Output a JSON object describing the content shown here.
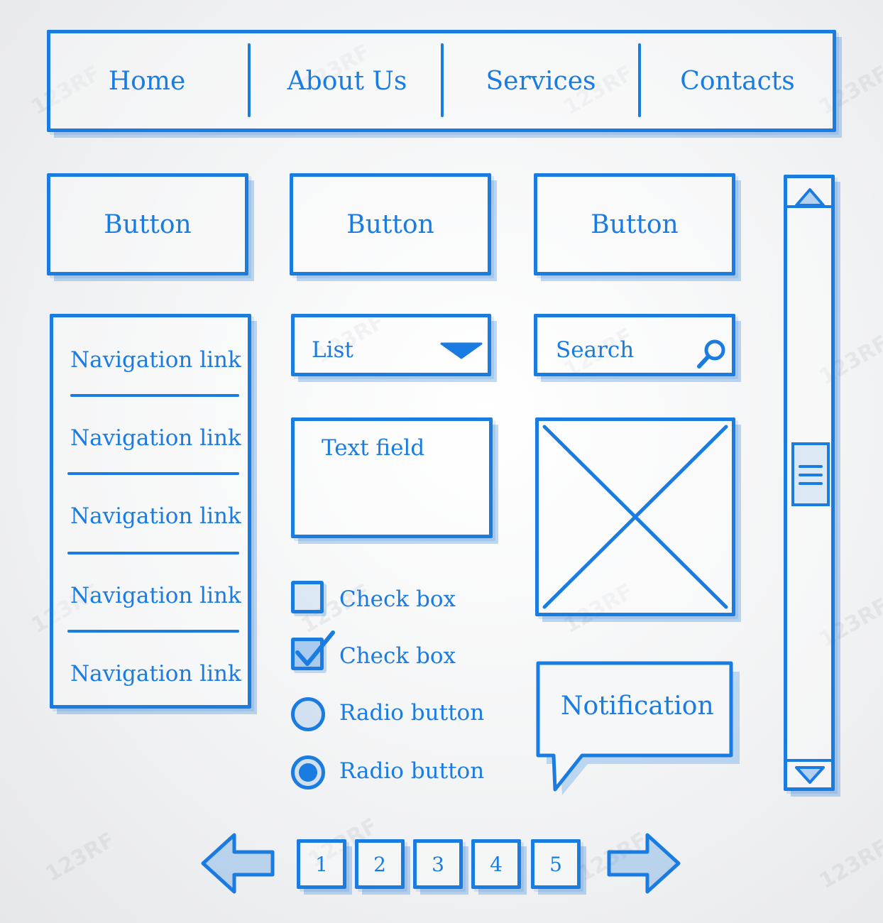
{
  "topnav": {
    "items": [
      {
        "label": "Home"
      },
      {
        "label": "About Us"
      },
      {
        "label": "Services"
      },
      {
        "label": "Contacts"
      }
    ]
  },
  "buttons": [
    {
      "label": "Button"
    },
    {
      "label": "Button"
    },
    {
      "label": "Button"
    }
  ],
  "sidebar": {
    "links": [
      {
        "label": "Navigation link"
      },
      {
        "label": "Navigation link"
      },
      {
        "label": "Navigation link"
      },
      {
        "label": "Navigation link"
      },
      {
        "label": "Navigation link"
      }
    ]
  },
  "list": {
    "label": "List",
    "icon": "dropdown-arrow-icon"
  },
  "search": {
    "placeholder": "Search",
    "icon": "magnifier-icon"
  },
  "textfield": {
    "placeholder": "Text field"
  },
  "image_placeholder": {
    "icon": "image-placeholder-icon"
  },
  "checkboxes": [
    {
      "label": "Check box",
      "checked": false
    },
    {
      "label": "Check box",
      "checked": true
    }
  ],
  "radios": [
    {
      "label": "Radio button",
      "selected": false
    },
    {
      "label": "Radio button",
      "selected": true
    }
  ],
  "notification": {
    "label": "Notification"
  },
  "pagination": {
    "pages": [
      "1",
      "2",
      "3",
      "4",
      "5"
    ],
    "prev_icon": "arrow-left-icon",
    "next_icon": "arrow-right-icon"
  },
  "scrollbar": {
    "up_icon": "scroll-up-icon",
    "down_icon": "scroll-down-icon",
    "thumb_icon": "grip-icon"
  },
  "colors": {
    "sketch": "#1a7be0",
    "background": "#f2f3f4"
  },
  "watermark": "123RF"
}
